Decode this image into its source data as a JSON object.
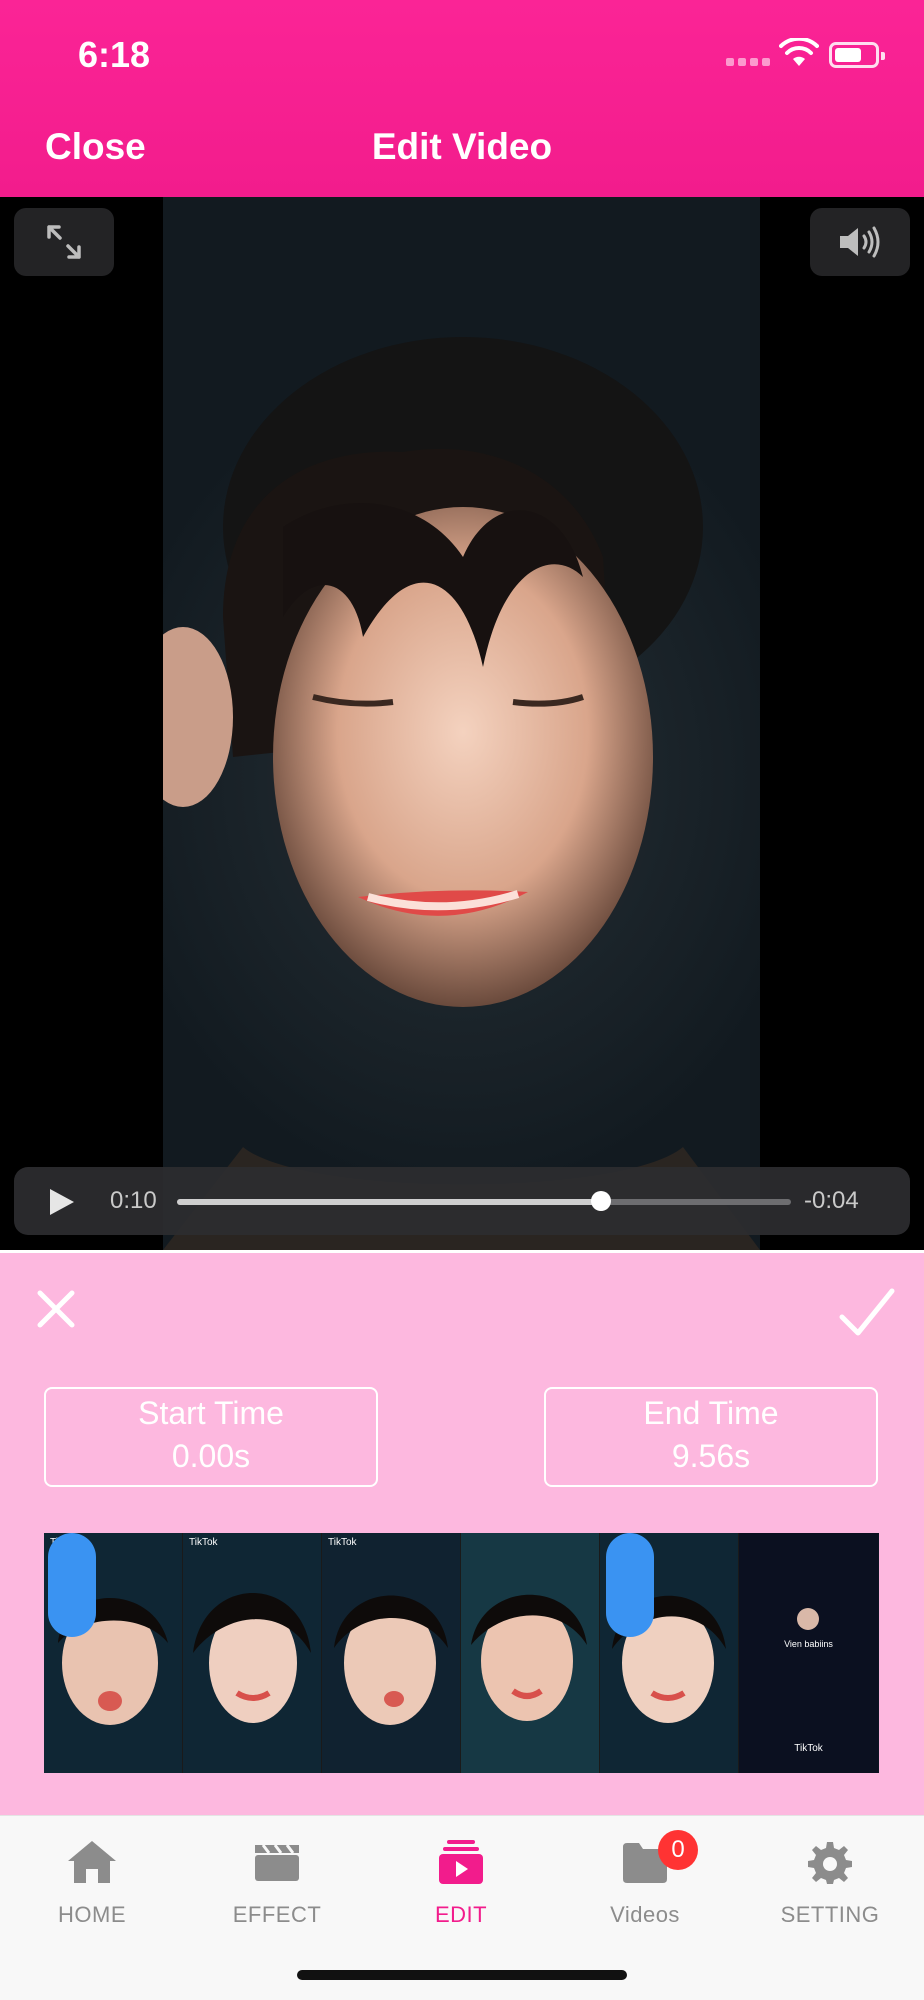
{
  "status_bar": {
    "time": "6:18"
  },
  "header": {
    "close_label": "Close",
    "title": "Edit Video"
  },
  "player": {
    "current_time": "0:10",
    "remaining_time": "-0:04",
    "progress_fraction": 0.69
  },
  "trim": {
    "start_label": "Start Time",
    "start_value": "0.00s",
    "end_label": "End Time",
    "end_value": "9.56s",
    "thumbnail_tag": "TikTok",
    "last_frame_name": "Vien babiins",
    "last_frame_logo": "TikTok"
  },
  "tabs": [
    {
      "label": "HOME",
      "icon": "home-icon"
    },
    {
      "label": "EFFECT",
      "icon": "clapperboard-icon"
    },
    {
      "label": "EDIT",
      "icon": "edit-video-icon",
      "active": true
    },
    {
      "label": "Videos",
      "icon": "folder-icon",
      "badge": "0"
    },
    {
      "label": "SETTING",
      "icon": "gear-icon"
    }
  ],
  "colors": {
    "brand": "#f21c8c",
    "panel": "#fdb8df",
    "handle": "#3a93f2",
    "badge": "#ff3333"
  }
}
